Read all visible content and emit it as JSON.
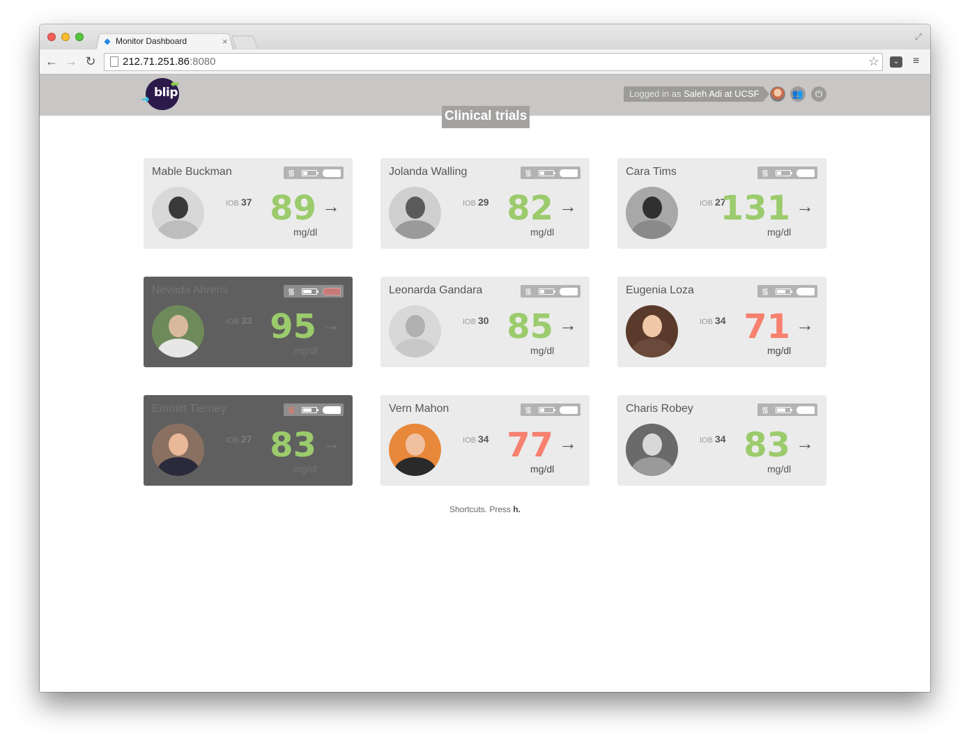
{
  "browser": {
    "tab_title": "Monitor Dashboard",
    "tab_close": "×",
    "url_host": "212.71.251.86",
    "url_port": ":8080"
  },
  "header": {
    "logo_text": "blip",
    "logged_prefix": "Logged in as ",
    "logged_user": "Saleh Adi at UCSF",
    "page_title": "Clinical trials"
  },
  "unit_label": "mg/dl",
  "iob_label": "IOB",
  "arrow_glyph": "→",
  "patients": [
    {
      "name": "Mable Buckman",
      "iob": "37",
      "bg": "89",
      "bg_color": "green",
      "offline": false
    },
    {
      "name": "Jolanda Walling",
      "iob": "29",
      "bg": "82",
      "bg_color": "green",
      "offline": false
    },
    {
      "name": "Cara Tims",
      "iob": "27",
      "bg": "131",
      "bg_color": "green",
      "offline": false
    },
    {
      "name": "Nevada Ahrens",
      "iob": "33",
      "bg": "95",
      "bg_color": "green",
      "offline": true
    },
    {
      "name": "Leonarda Gandara",
      "iob": "30",
      "bg": "85",
      "bg_color": "green",
      "offline": false
    },
    {
      "name": "Eugenia Loza",
      "iob": "34",
      "bg": "71",
      "bg_color": "red",
      "offline": false
    },
    {
      "name": "Emmitt Tierney",
      "iob": "27",
      "bg": "83",
      "bg_color": "green",
      "offline": true
    },
    {
      "name": "Vern Mahon",
      "iob": "34",
      "bg": "77",
      "bg_color": "red",
      "offline": false
    },
    {
      "name": "Charis Robey",
      "iob": "34",
      "bg": "83",
      "bg_color": "green",
      "offline": false
    }
  ],
  "footer": {
    "shortcuts_text": "Shortcuts. Press ",
    "shortcuts_key": "h."
  },
  "colors": {
    "bg_green": "#9bcb6c",
    "bg_red": "#f7806f",
    "card_bg": "#ebebeb",
    "card_offline_bg": "#5f5f5f"
  }
}
